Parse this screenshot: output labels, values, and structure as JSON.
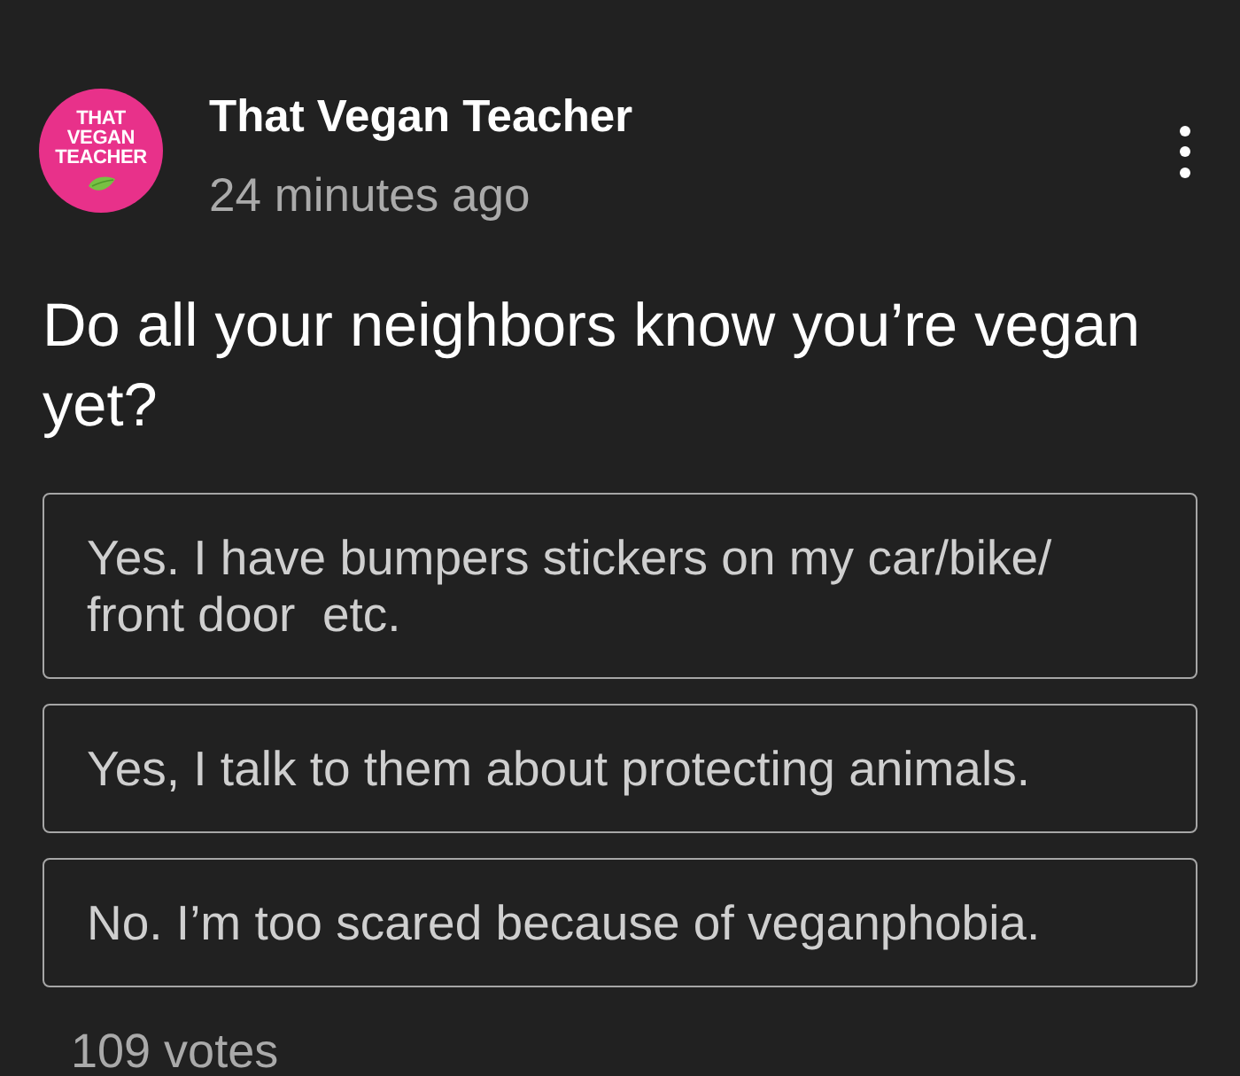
{
  "post": {
    "avatar": {
      "text": "THAT VEGAN TEACHER"
    },
    "author": "That Vegan Teacher",
    "time": "24 minutes ago"
  },
  "poll": {
    "question": "Do all your neighbors know you’re vegan yet?",
    "options": [
      {
        "label": "Yes. I have bumpers stickers on my car/bike/front door  etc."
      },
      {
        "label": "Yes, I talk to them about protecting animals."
      },
      {
        "label": "No. I’m too scared because of veganphobia."
      }
    ],
    "votes": "109 votes"
  }
}
